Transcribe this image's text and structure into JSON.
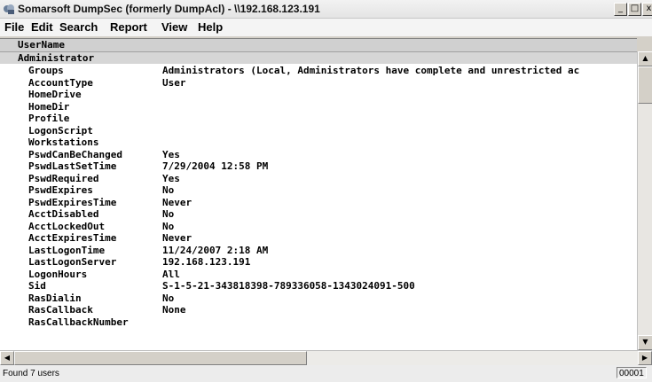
{
  "window": {
    "title": "Somarsoft DumpSec (formerly DumpAcl) - \\\\192.168.123.191",
    "minimize_label": "_",
    "maximize_label": "□",
    "close_label": "x"
  },
  "menu": [
    "File",
    "Edit",
    "Search",
    "Report",
    "View",
    "Help"
  ],
  "list": {
    "header": "UserName",
    "group": "Administrator",
    "rows": [
      {
        "field": "Groups",
        "value": "Administrators (Local, Administrators have complete and unrestricted ac"
      },
      {
        "field": "AccountType",
        "value": "User"
      },
      {
        "field": "HomeDrive",
        "value": ""
      },
      {
        "field": "HomeDir",
        "value": ""
      },
      {
        "field": "Profile",
        "value": ""
      },
      {
        "field": "LogonScript",
        "value": ""
      },
      {
        "field": "Workstations",
        "value": ""
      },
      {
        "field": "PswdCanBeChanged",
        "value": "Yes"
      },
      {
        "field": "PswdLastSetTime",
        "value": "7/29/2004 12:58 PM"
      },
      {
        "field": "PswdRequired",
        "value": "Yes"
      },
      {
        "field": "PswdExpires",
        "value": "No"
      },
      {
        "field": "PswdExpiresTime",
        "value": "Never"
      },
      {
        "field": "AcctDisabled",
        "value": "No"
      },
      {
        "field": "AcctLockedOut",
        "value": "No"
      },
      {
        "field": "AcctExpiresTime",
        "value": "Never"
      },
      {
        "field": "LastLogonTime",
        "value": "11/24/2007 2:18 AM"
      },
      {
        "field": "LastLogonServer",
        "value": "192.168.123.191"
      },
      {
        "field": "LogonHours",
        "value": "All"
      },
      {
        "field": "Sid",
        "value": "S-1-5-21-343818398-789336058-1343024091-500"
      },
      {
        "field": "RasDialin",
        "value": "No"
      },
      {
        "field": "RasCallback",
        "value": "None"
      },
      {
        "field": "RasCallbackNumber",
        "value": ""
      }
    ]
  },
  "scroll": {
    "up_arrow": "▲",
    "down_arrow": "▼",
    "left_arrow": "◀",
    "right_arrow": "▶"
  },
  "status": {
    "text": "Found 7 users",
    "panel": "00001"
  }
}
